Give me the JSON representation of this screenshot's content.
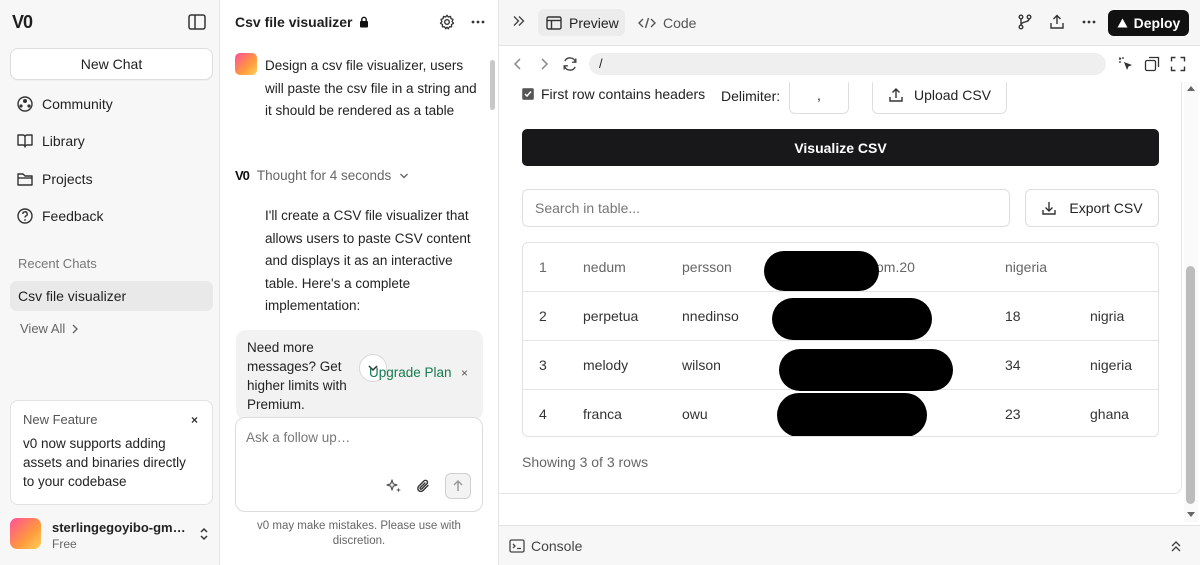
{
  "sidebar": {
    "logo": "V0",
    "new_chat": "New Chat",
    "nav": [
      {
        "label": "Community",
        "icon": "community-icon"
      },
      {
        "label": "Library",
        "icon": "book-icon"
      },
      {
        "label": "Projects",
        "icon": "folder-icon"
      },
      {
        "label": "Feedback",
        "icon": "help-icon"
      }
    ],
    "recent_label": "Recent Chats",
    "recent_items": [
      "Csv file visualizer"
    ],
    "view_all": "View All",
    "feature": {
      "title": "New Feature",
      "body": "v0 now supports adding assets and binaries directly to your codebase",
      "close": "×"
    },
    "user": {
      "name": "sterlingegoyibo-gm…",
      "plan": "Free"
    }
  },
  "chat": {
    "title": "Csv file visualizer",
    "user_message": "Design a csv file visualizer, users will paste the csv file in a string and it should be rendered as a table",
    "thought": "Thought for 4 seconds",
    "thought_logo": "V0",
    "ai_message": "I'll create a CSV file visualizer that allows users to paste CSV content and displays it as an interactive table. Here's a complete implementation:",
    "upgrade": {
      "text": "Need more messages? Get higher limits with Premium.",
      "link": "Upgrade Plan",
      "close": "×"
    },
    "composer_placeholder": "Ask a follow up…",
    "disclaimer": "v0 may make mistakes. Please use with discretion."
  },
  "topbar": {
    "tabs": [
      {
        "label": "Preview",
        "active": true
      },
      {
        "label": "Code",
        "active": false
      }
    ],
    "deploy": "Deploy"
  },
  "preview": {
    "url": "/",
    "header_checkbox_label": "First row contains headers",
    "header_checkbox_checked": true,
    "delimiter_label": "Delimiter:",
    "delimiter_value": ",",
    "upload_label": "Upload CSV",
    "visualize_label": "Visualize CSV",
    "search_placeholder": "Search in table...",
    "export_label": "Export CSV",
    "table": {
      "rows": [
        [
          "1",
          "nedum",
          "persson",
          "om.20",
          "nigeria",
          ""
        ],
        [
          "2",
          "perpetua",
          "nnedinso",
          "",
          "18",
          "nigria"
        ],
        [
          "3",
          "melody",
          "wilson",
          "",
          "34",
          "nigeria"
        ],
        [
          "4",
          "franca",
          "owu",
          "",
          "23",
          "ghana"
        ]
      ]
    },
    "row_count": "Showing 3 of 3 rows",
    "console": "Console"
  },
  "colors": {
    "accent_link": "#157a4e",
    "primary_button": "#18181b",
    "deploy_button": "#111111"
  }
}
